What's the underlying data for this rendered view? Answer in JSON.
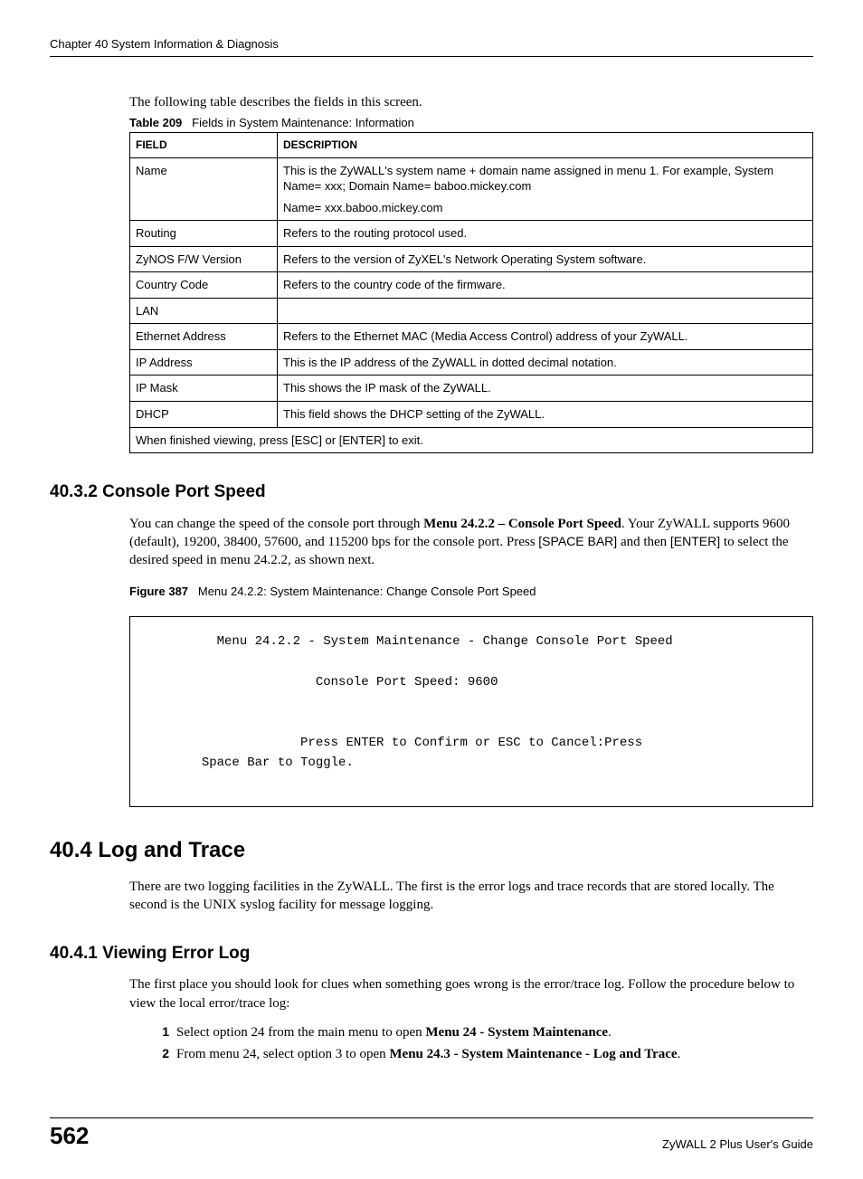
{
  "header": {
    "text": "Chapter 40 System Information & Diagnosis"
  },
  "intro": "The following table describes the fields in this screen.",
  "table_caption": {
    "label": "Table 209",
    "title": "Fields in System Maintenance: Information"
  },
  "table": {
    "head": {
      "field": "FIELD",
      "desc": "DESCRIPTION"
    },
    "rows": [
      {
        "field": "Name",
        "desc": "This is the ZyWALL's system name + domain name assigned in menu 1. For example, System Name= xxx; Domain Name= baboo.mickey.com\nName= xxx.baboo.mickey.com"
      },
      {
        "field": "Routing",
        "desc": "Refers to the routing protocol used."
      },
      {
        "field": "ZyNOS F/W Version",
        "desc": "Refers to the version of ZyXEL's Network Operating System software."
      },
      {
        "field": "Country Code",
        "desc": "Refers to the country code of the firmware."
      },
      {
        "field": "LAN",
        "desc": ""
      },
      {
        "field": "Ethernet Address",
        "desc": "Refers to the Ethernet MAC (Media Access Control) address of your ZyWALL."
      },
      {
        "field": "IP Address",
        "desc": "This is the IP address of the ZyWALL in dotted decimal notation."
      },
      {
        "field": "IP Mask",
        "desc": "This shows the IP mask of the ZyWALL."
      },
      {
        "field": "DHCP",
        "desc": "This field shows the DHCP setting of the ZyWALL."
      }
    ],
    "footer_row": "When finished viewing, press [ESC] or [ENTER] to exit."
  },
  "sec_4032": {
    "heading": "40.3.2  Console Port Speed",
    "para_parts": {
      "p1a": "You can change the speed of the console port through ",
      "p1b_bold": "Menu 24.2.2 – Console Port Speed",
      "p1c": ". Your ZyWALL supports 9600 (default), 19200, 38400, 57600, and 115200 bps for the console port. Press ",
      "p1d_sans": "[SPACE BAR]",
      "p1e": " and then ",
      "p1f_sans": "[ENTER]",
      "p1g": " to select the desired speed in menu 24.2.2, as shown next."
    },
    "figure_caption": {
      "label": "Figure 387",
      "title": "Menu 24.2.2: System Maintenance: Change  Console Port Speed"
    },
    "console": "         Menu 24.2.2 - System Maintenance - Change Console Port Speed\n\n                      Console Port Speed: 9600\n\n\n                    Press ENTER to Confirm or ESC to Cancel:Press\n       Space Bar to Toggle."
  },
  "sec_404": {
    "heading": "40.4  Log and Trace",
    "para": "There are two logging facilities in the ZyWALL. The first is the error logs and trace records that are stored locally. The second is the UNIX syslog facility for message logging."
  },
  "sec_4041": {
    "heading": "40.4.1  Viewing Error Log",
    "para": "The first place you should look for clues when something goes wrong is the error/trace log. Follow the procedure below to view the local error/trace log:",
    "steps": [
      {
        "n": "1",
        "pre": "Select option 24 from the main menu to open ",
        "bold": "Menu 24 - System Maintenance",
        "post": "."
      },
      {
        "n": "2",
        "pre": "From menu 24, select option 3 to open ",
        "bold": "Menu 24.3 - System Maintenance - Log and Trace",
        "post": "."
      }
    ]
  },
  "footer": {
    "page": "562",
    "title": "ZyWALL 2 Plus User's Guide"
  }
}
